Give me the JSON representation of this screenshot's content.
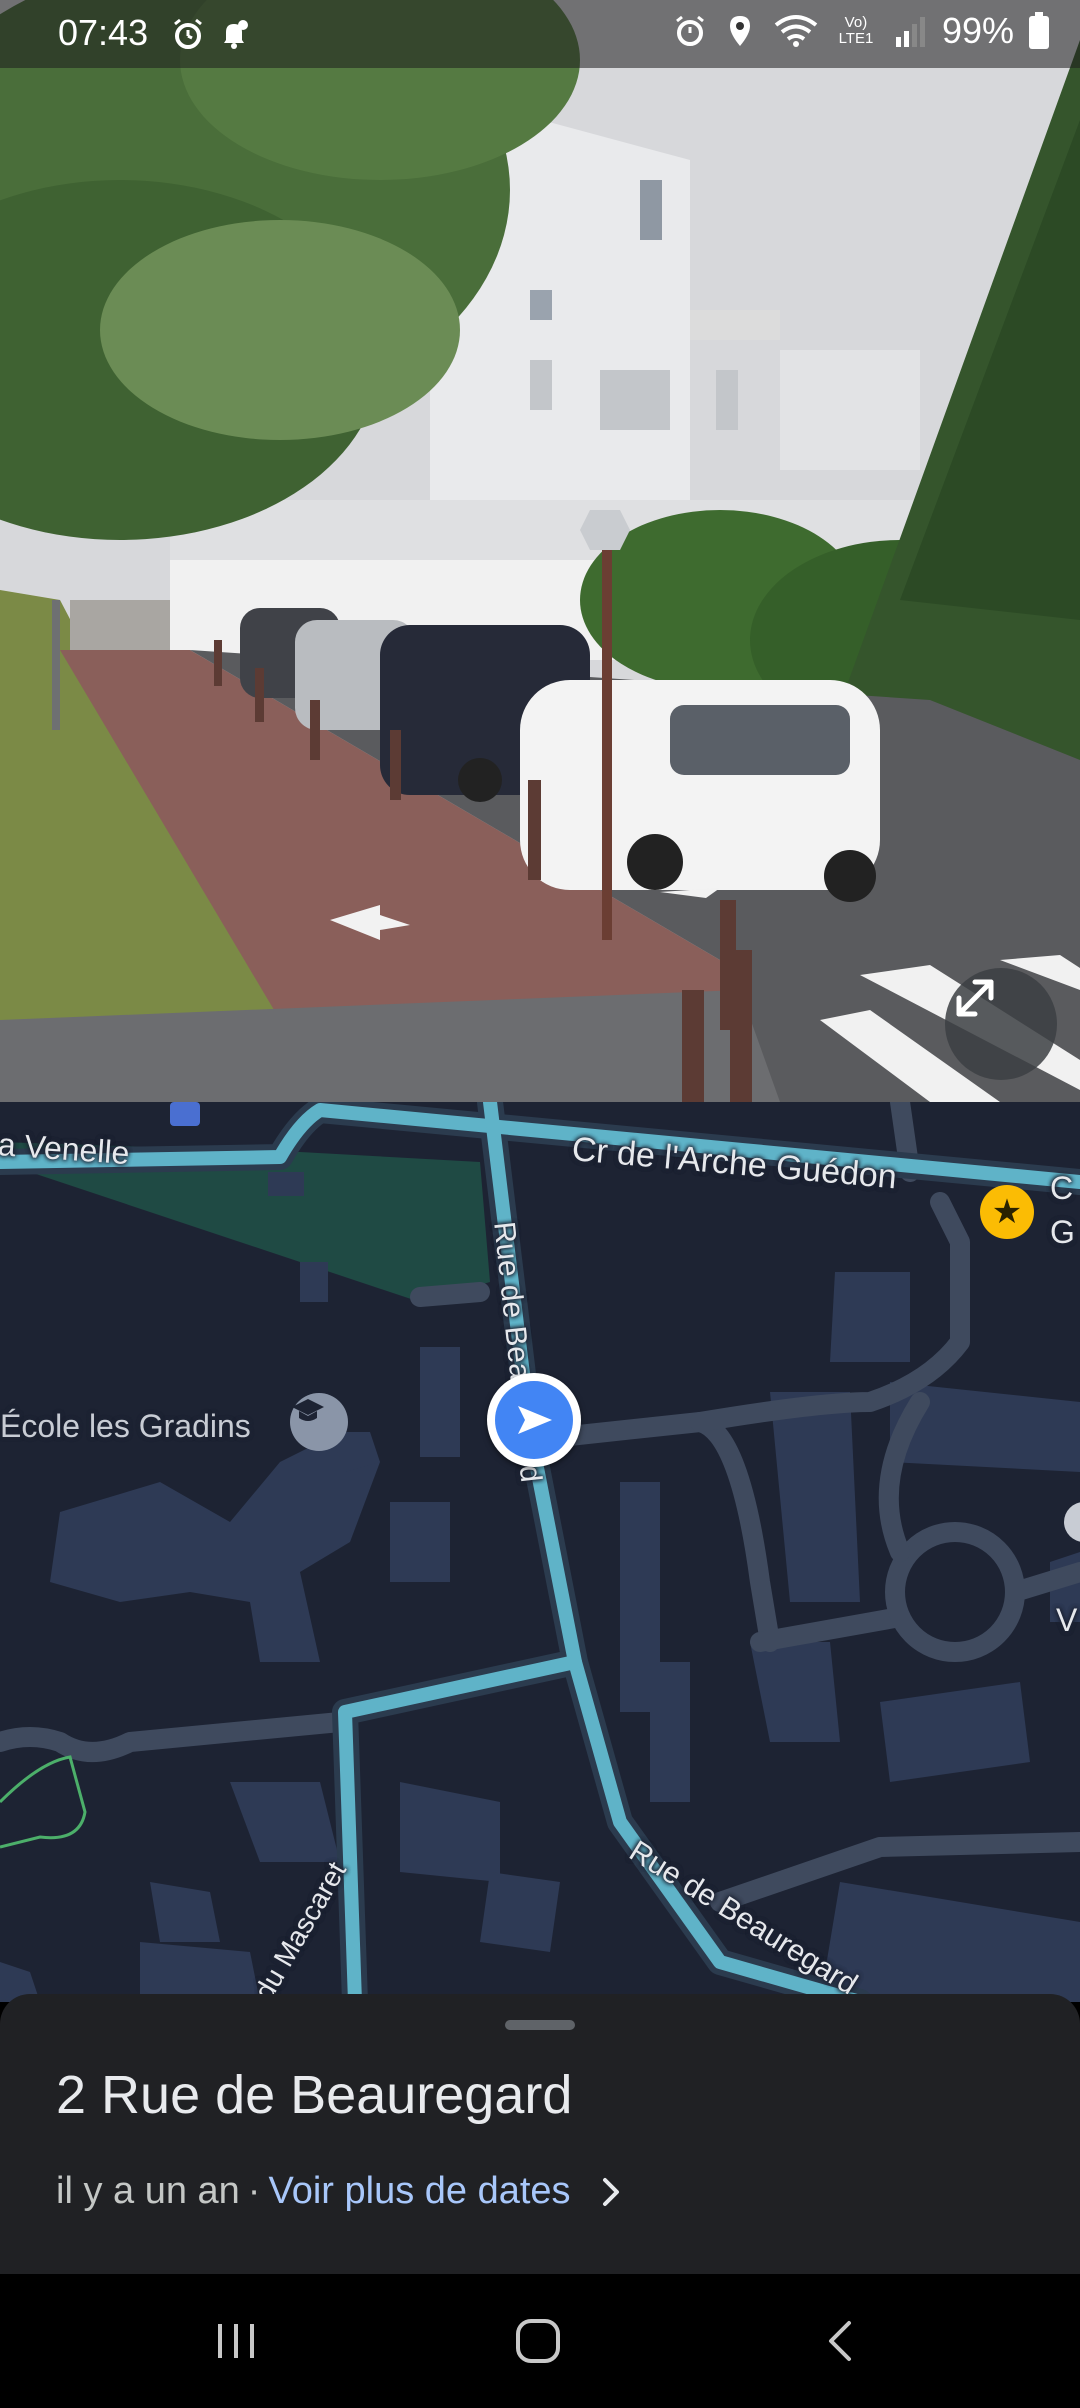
{
  "status_bar": {
    "time": "07:43",
    "battery_percent": "99%",
    "left_icons": [
      "alarm-icon",
      "bell-notification-icon"
    ],
    "right_icons": [
      "alarm-icon",
      "location-icon",
      "wifi-icon",
      "volte-icon",
      "signal-icon",
      "battery-icon"
    ],
    "volte_label": "Vo) LTE1"
  },
  "street_view": {
    "expand_button_icon": "expand-diagonal-icon"
  },
  "map": {
    "labels": {
      "venelle": "a Venelle",
      "arche_guedon": "Cr de l'Arche Guédon",
      "edge_c": "C",
      "edge_g": "G",
      "edge_v": "V",
      "rue_beauregard_upper": "Rue de Beauregard",
      "rue_beauregard_lower": "Rue de Beauregard",
      "ecole": "École les Gradins",
      "mascaret": "du Mascaret"
    },
    "colors": {
      "background": "#1d2333",
      "road": "#3f4a5e",
      "streetview_highlight": "#5fb3c8",
      "park": "#1f4a44",
      "building": "#2e3a55",
      "user_marker": "#4285f4"
    }
  },
  "sheet": {
    "address": "2 Rue de Beauregard",
    "date_text": "il y a un an",
    "separator": "·",
    "more_dates_link": "Voir plus de dates"
  },
  "navbar": {
    "recent_icon": "recent-apps-icon",
    "home_icon": "home-icon",
    "back_icon": "back-icon"
  }
}
